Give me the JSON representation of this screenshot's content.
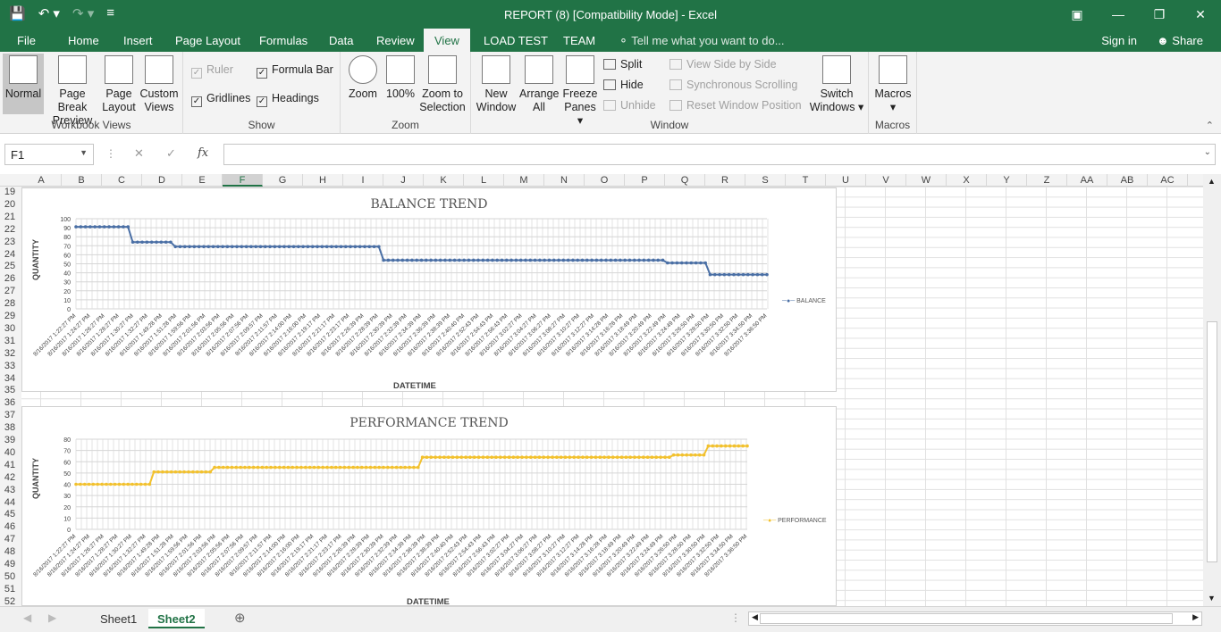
{
  "window": {
    "title": "REPORT (8)  [Compatibility Mode] - Excel"
  },
  "qat": {
    "save": "save-icon",
    "undo": "undo-icon",
    "redo": "redo-icon",
    "customize": "customize-icon"
  },
  "tabs": {
    "file": "File",
    "home": "Home",
    "insert": "Insert",
    "page_layout": "Page Layout",
    "formulas": "Formulas",
    "data": "Data",
    "review": "Review",
    "view": "View",
    "load_test": "LOAD TEST",
    "team": "TEAM",
    "tell_me": "Tell me what you want to do...",
    "sign_in": "Sign in",
    "share": "Share"
  },
  "ribbon": {
    "workbook_views": {
      "label": "Workbook Views",
      "normal": "Normal",
      "page_break_1": "Page Break",
      "page_break_2": "Preview",
      "page_layout_1": "Page",
      "page_layout_2": "Layout",
      "custom_1": "Custom",
      "custom_2": "Views"
    },
    "show": {
      "label": "Show",
      "ruler": "Ruler",
      "formula_bar": "Formula Bar",
      "gridlines": "Gridlines",
      "headings": "Headings"
    },
    "zoom": {
      "label": "Zoom",
      "zoom": "Zoom",
      "hundred": "100%",
      "zoom_sel_1": "Zoom to",
      "zoom_sel_2": "Selection"
    },
    "window": {
      "label": "Window",
      "new_1": "New",
      "new_2": "Window",
      "arrange_1": "Arrange",
      "arrange_2": "All",
      "freeze_1": "Freeze",
      "freeze_2": "Panes",
      "split": "Split",
      "hide": "Hide",
      "unhide": "Unhide",
      "side_by_side": "View Side by Side",
      "sync": "Synchronous Scrolling",
      "reset": "Reset Window Position",
      "switch_1": "Switch",
      "switch_2": "Windows"
    },
    "macros": {
      "label": "Macros",
      "macros": "Macros"
    }
  },
  "formula_bar": {
    "name_box": "F1",
    "fx": "fx",
    "value": ""
  },
  "columns": [
    "A",
    "B",
    "C",
    "D",
    "E",
    "F",
    "G",
    "H",
    "I",
    "J",
    "K",
    "L",
    "M",
    "N",
    "O",
    "P",
    "Q",
    "R",
    "S",
    "T",
    "U",
    "V",
    "W",
    "X",
    "Y",
    "Z",
    "AA",
    "AB",
    "AC"
  ],
  "rows": [
    "19",
    "20",
    "21",
    "22",
    "23",
    "24",
    "25",
    "26",
    "27",
    "28",
    "29",
    "30",
    "31",
    "32",
    "33",
    "34",
    "35",
    "36",
    "37",
    "38",
    "39",
    "40",
    "41",
    "42",
    "43",
    "44",
    "45",
    "46",
    "47",
    "48",
    "49",
    "50",
    "51",
    "52"
  ],
  "chart_data": [
    {
      "type": "line",
      "title": "BALANCE TREND",
      "xlabel": "DATETIME",
      "ylabel": "QUANTITY",
      "ylim": [
        0,
        100
      ],
      "yticks": [
        "0",
        "10",
        "20",
        "30",
        "40",
        "50",
        "60",
        "70",
        "80",
        "90",
        "100"
      ],
      "legend": "right",
      "grid": true,
      "x": [
        "8/16/2017 1:22:27 PM",
        "8/16/2017 1:24:27 PM",
        "8/16/2017 1:26:27 PM",
        "8/16/2017 1:28:27 PM",
        "8/16/2017 1:30:27 PM",
        "8/16/2017 1:32:27 PM",
        "8/16/2017 1:49:28 PM",
        "8/16/2017 1:51:28 PM",
        "8/16/2017 1:59:56 PM",
        "8/16/2017 2:01:56 PM",
        "8/16/2017 2:03:56 PM",
        "8/16/2017 2:05:56 PM",
        "8/16/2017 2:07:56 PM",
        "8/16/2017 2:09:57 PM",
        "8/16/2017 2:11:57 PM",
        "8/16/2017 2:14:00 PM",
        "8/16/2017 2:16:00 PM",
        "8/16/2017 2:19:17 PM",
        "8/16/2017 2:21:17 PM",
        "8/16/2017 2:23:17 PM",
        "8/16/2017 2:26:39 PM",
        "8/16/2017 2:28:39 PM",
        "8/16/2017 2:30:39 PM",
        "8/16/2017 2:32:39 PM",
        "8/16/2017 2:34:39 PM",
        "8/16/2017 2:36:39 PM",
        "8/16/2017 2:38:39 PM",
        "8/16/2017 2:40:40 PM",
        "8/16/2017 2:52:43 PM",
        "8/16/2017 2:54:43 PM",
        "8/16/2017 2:56:43 PM",
        "8/16/2017 3:02:27 PM",
        "8/16/2017 3:04:27 PM",
        "8/16/2017 3:06:27 PM",
        "8/16/2017 3:08:27 PM",
        "8/16/2017 3:10:27 PM",
        "8/16/2017 3:12:27 PM",
        "8/16/2017 3:14:28 PM",
        "8/16/2017 3:16:28 PM",
        "8/16/2017 3:18:49 PM",
        "8/16/2017 3:20:49 PM",
        "8/16/2017 3:22:49 PM",
        "8/16/2017 3:24:49 PM",
        "8/16/2017 3:26:50 PM",
        "8/16/2017 3:28:50 PM",
        "8/16/2017 3:30:50 PM",
        "8/16/2017 3:32:50 PM",
        "8/16/2017 3:34:50 PM",
        "8/16/2017 3:36:50 PM"
      ],
      "series": [
        {
          "name": "BALANCE",
          "color": "#4a6fa5",
          "values": [
            91,
            91,
            91,
            91,
            91,
            91,
            91,
            91,
            91,
            91,
            91,
            91,
            74,
            74,
            74,
            74,
            74,
            74,
            74,
            74,
            74,
            69,
            69,
            69,
            69,
            69,
            69,
            69,
            69,
            69,
            69,
            69,
            69,
            69,
            69,
            69,
            69,
            69,
            69,
            69,
            69,
            69,
            69,
            69,
            69,
            69,
            69,
            69,
            69,
            69,
            69,
            69,
            69,
            69,
            69,
            69,
            69,
            69,
            69,
            69,
            69,
            69,
            69,
            69,
            69,
            54,
            54,
            54,
            54,
            54,
            54,
            54,
            54,
            54,
            54,
            54,
            54,
            54,
            54,
            54,
            54,
            54,
            54,
            54,
            54,
            54,
            54,
            54,
            54,
            54,
            54,
            54,
            54,
            54,
            54,
            54,
            54,
            54,
            54,
            54,
            54,
            54,
            54,
            54,
            54,
            54,
            54,
            54,
            54,
            54,
            54,
            54,
            54,
            54,
            54,
            54,
            54,
            54,
            54,
            54,
            54,
            54,
            54,
            54,
            54,
            51,
            51,
            51,
            51,
            51,
            51,
            51,
            51,
            51,
            38,
            38,
            38,
            38,
            38,
            38,
            38,
            38,
            38,
            38,
            38,
            38,
            38
          ]
        }
      ]
    },
    {
      "type": "line",
      "title": "PERFORMANCE TREND",
      "xlabel": "DATETIME",
      "ylabel": "QUANTITY",
      "ylim": [
        0,
        80
      ],
      "yticks": [
        "0",
        "10",
        "20",
        "30",
        "40",
        "50",
        "60",
        "70",
        "80"
      ],
      "legend": "right",
      "grid": true,
      "x": [
        "8/16/2017 1:22:27 PM",
        "8/16/2017 1:24:27 PM",
        "8/16/2017 1:26:27 PM",
        "8/16/2017 1:28:27 PM",
        "8/16/2017 1:30:27 PM",
        "8/16/2017 1:32:27 PM",
        "8/16/2017 1:49:28 PM",
        "8/16/2017 1:51:28 PM",
        "8/16/2017 1:59:56 PM",
        "8/16/2017 2:01:56 PM",
        "8/16/2017 2:03:56 PM",
        "8/16/2017 2:05:56 PM",
        "8/16/2017 2:07:56 PM",
        "8/16/2017 2:09:57 PM",
        "8/16/2017 2:11:57 PM",
        "8/16/2017 2:14:00 PM",
        "8/16/2017 2:16:00 PM",
        "8/16/2017 2:19:17 PM",
        "8/16/2017 2:21:17 PM",
        "8/16/2017 2:23:17 PM",
        "8/16/2017 2:26:39 PM",
        "8/16/2017 2:28:39 PM",
        "8/16/2017 2:30:39 PM",
        "8/16/2017 2:32:39 PM",
        "8/16/2017 2:34:39 PM",
        "8/16/2017 2:36:39 PM",
        "8/16/2017 2:38:39 PM",
        "8/16/2017 2:40:40 PM",
        "8/16/2017 2:52:43 PM",
        "8/16/2017 2:54:43 PM",
        "8/16/2017 2:56:43 PM",
        "8/16/2017 3:02:27 PM",
        "8/16/2017 3:04:27 PM",
        "8/16/2017 3:06:27 PM",
        "8/16/2017 3:08:27 PM",
        "8/16/2017 3:10:27 PM",
        "8/16/2017 3:12:27 PM",
        "8/16/2017 3:14:28 PM",
        "8/16/2017 3:16:28 PM",
        "8/16/2017 3:18:49 PM",
        "8/16/2017 3:20:49 PM",
        "8/16/2017 3:22:49 PM",
        "8/16/2017 3:24:49 PM",
        "8/16/2017 3:26:50 PM",
        "8/16/2017 3:28:50 PM",
        "8/16/2017 3:30:50 PM",
        "8/16/2017 3:32:50 PM",
        "8/16/2017 3:34:50 PM",
        "8/16/2017 3:36:50 PM"
      ],
      "series": [
        {
          "name": "PERFORMANCE",
          "color": "#f2c12e",
          "values": [
            40,
            40,
            40,
            40,
            40,
            40,
            40,
            40,
            40,
            40,
            40,
            40,
            40,
            40,
            40,
            40,
            40,
            40,
            51,
            51,
            51,
            51,
            51,
            51,
            51,
            51,
            51,
            51,
            51,
            51,
            51,
            51,
            55,
            55,
            55,
            55,
            55,
            55,
            55,
            55,
            55,
            55,
            55,
            55,
            55,
            55,
            55,
            55,
            55,
            55,
            55,
            55,
            55,
            55,
            55,
            55,
            55,
            55,
            55,
            55,
            55,
            55,
            55,
            55,
            55,
            55,
            55,
            55,
            55,
            55,
            55,
            55,
            55,
            55,
            55,
            55,
            55,
            55,
            55,
            55,
            64,
            64,
            64,
            64,
            64,
            64,
            64,
            64,
            64,
            64,
            64,
            64,
            64,
            64,
            64,
            64,
            64,
            64,
            64,
            64,
            64,
            64,
            64,
            64,
            64,
            64,
            64,
            64,
            64,
            64,
            64,
            64,
            64,
            64,
            64,
            64,
            64,
            64,
            64,
            64,
            64,
            64,
            64,
            64,
            64,
            64,
            64,
            64,
            64,
            64,
            64,
            64,
            64,
            64,
            64,
            64,
            64,
            64,
            66,
            66,
            66,
            66,
            66,
            66,
            66,
            66,
            74,
            74,
            74,
            74,
            74,
            74,
            74,
            74,
            74,
            74
          ]
        }
      ]
    }
  ],
  "sheets": [
    "Sheet1",
    "Sheet2"
  ],
  "active_sheet": "Sheet2"
}
